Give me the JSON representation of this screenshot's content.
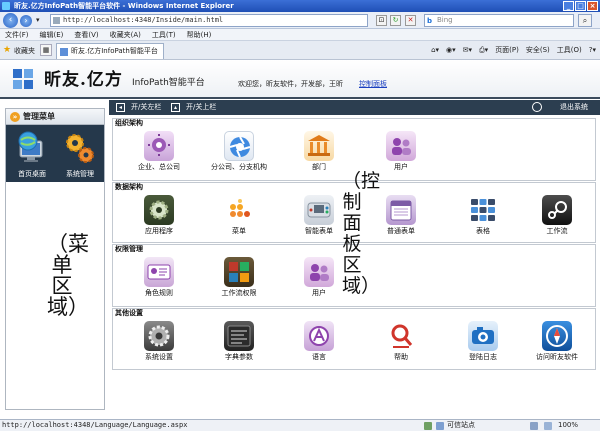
{
  "window": {
    "title": "昕友.亿方InfoPath智能平台软件 - Windows Internet Explorer",
    "controls": [
      "_",
      "□",
      "×"
    ]
  },
  "address_bar": {
    "url": "http://localhost:4348/Inside/main.html",
    "search_placeholder": "Bing",
    "search_brand": "b"
  },
  "menu": [
    "文件(F)",
    "编辑(E)",
    "查看(V)",
    "收藏夹(A)",
    "工具(T)",
    "帮助(H)"
  ],
  "favorites": {
    "label": "收藏夹",
    "tab_title": "昕友.亿方InfoPath智能平台软件",
    "commands": [
      "页面(P)",
      "安全(S)",
      "工具(O)"
    ]
  },
  "header": {
    "logo_text": "昕友.亿方",
    "logo_sub": "InfoPath智能平台",
    "welcome": "欢迎您，昕友软件，开发部，王昕",
    "control_panel_link": "控制面板",
    "logo_colors": [
      "#2f6fc9",
      "#6aa6e6",
      "#6aa6e6",
      "#2f6fc9"
    ]
  },
  "sidebar": {
    "title": "管理菜单",
    "items": [
      {
        "label": "首页桌面",
        "icon": "desktop-globe-icon"
      },
      {
        "label": "系统管理",
        "icon": "gears-icon"
      }
    ],
    "annotation": "（菜单区域）"
  },
  "content_toolbar": {
    "toggle_left": "开/关左栏",
    "toggle_top": "开/关上栏",
    "exit": "退出系统"
  },
  "annotation_right": "（控制面板区域）",
  "sections": [
    {
      "title": "组织架构",
      "items": [
        {
          "label": "企业、总公司",
          "icon": "enterprise-icon"
        },
        {
          "label": "分公司、分支机构",
          "icon": "branch-icon"
        },
        {
          "label": "部门",
          "icon": "department-icon"
        },
        {
          "label": "用户",
          "icon": "users-icon"
        }
      ]
    },
    {
      "title": "数据架构",
      "items": [
        {
          "label": "应用程序",
          "icon": "application-icon"
        },
        {
          "label": "菜单",
          "icon": "menu-icon"
        },
        {
          "label": "智能表单",
          "icon": "smart-form-icon"
        },
        {
          "label": "普通表单",
          "icon": "calendar-form-icon"
        },
        {
          "label": "表格",
          "icon": "table-icon"
        },
        {
          "label": "工作流",
          "icon": "workflow-icon"
        }
      ]
    },
    {
      "title": "权限管理",
      "items": [
        {
          "label": "角色规则",
          "icon": "role-rules-icon"
        },
        {
          "label": "工作流权限",
          "icon": "workflow-permission-icon"
        },
        {
          "label": "用户",
          "icon": "users-icon"
        }
      ]
    },
    {
      "title": "其他设置",
      "items": [
        {
          "label": "系统设置",
          "icon": "system-settings-icon"
        },
        {
          "label": "字典参数",
          "icon": "dictionary-icon"
        },
        {
          "label": "语言",
          "icon": "language-icon"
        },
        {
          "label": "帮助",
          "icon": "help-icon"
        },
        {
          "label": "登陆日志",
          "icon": "login-log-icon"
        },
        {
          "label": "访问昕友软件",
          "icon": "visit-compass-icon"
        }
      ]
    }
  ],
  "statusbar": {
    "url": "http://localhost:4348/Language/Language.aspx",
    "zone": "可信站点",
    "zoom": "100%"
  }
}
